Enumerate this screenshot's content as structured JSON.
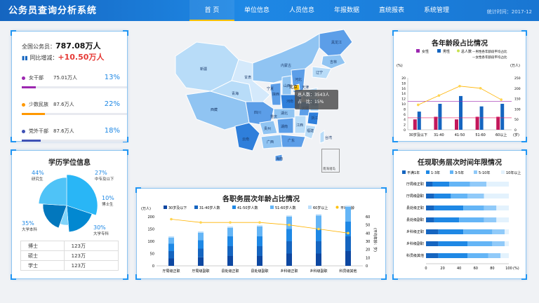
{
  "header": {
    "title": "公务员查询分析系统",
    "nav": [
      "首 页",
      "单位信息",
      "人员信息",
      "年报数据",
      "直统报表",
      "系统管理"
    ],
    "stat": "统计时间：2017-12"
  },
  "summary": {
    "total_label": "全国公务员：",
    "total_value": "787.08万人",
    "growth_label": "同比增减：",
    "growth_value": "+10.50万人",
    "items": [
      {
        "label": "女干部",
        "value": "75.01万人",
        "percent": "13%",
        "ratio": 0.13,
        "color": "#9c27b0"
      },
      {
        "label": "少数民族",
        "value": "87.6万人",
        "percent": "22%",
        "ratio": 0.22,
        "color": "#ff9800"
      },
      {
        "label": "党外干部",
        "value": "87.6万人",
        "percent": "18%",
        "ratio": 0.18,
        "color": "#3f51b5"
      }
    ]
  },
  "map": {
    "tooltip_title": "北京",
    "tooltip_count": "总人数：3543人",
    "tooltip_ratio": "占　比：15%",
    "inset_label": "南海诸岛",
    "provinces": [
      "黑龙江",
      "吉林",
      "辽宁",
      "内蒙古",
      "新疆",
      "西藏",
      "青海",
      "甘肃",
      "宁夏",
      "陕西",
      "山西",
      "河北",
      "山东",
      "河南",
      "四川",
      "重庆",
      "湖北",
      "湖南",
      "江西",
      "安徽",
      "江苏",
      "浙江",
      "福建",
      "广东",
      "广西",
      "贵州",
      "云南",
      "海南",
      "台湾",
      "天津",
      "北京"
    ]
  },
  "age_chart": {
    "title": "各年龄段占比情况",
    "legend": [
      "女性",
      "男性",
      "总人数",
      "男性各年龄段平均占比",
      "女性各年龄段平均占比"
    ],
    "ylabel_left": "(%)",
    "ylabel_right": "(万人)",
    "xunit": "(岁)",
    "categories": [
      "30岁及以下",
      "31-40",
      "41-50",
      "51-60",
      "60以上"
    ],
    "female": [
      4,
      5,
      4,
      5,
      5
    ],
    "male": [
      7,
      10,
      13,
      9,
      10
    ],
    "total": [
      120,
      165,
      210,
      200,
      145
    ],
    "male_avg": 11,
    "female_avg": 4.6,
    "y_left": [
      0,
      2,
      4,
      6,
      8,
      10,
      12,
      14,
      16,
      18,
      20
    ],
    "y_right": [
      0,
      50,
      100,
      150,
      200,
      250
    ]
  },
  "edu": {
    "title": "学历学位信息",
    "slices": [
      {
        "label": "研究生",
        "percent": "44%",
        "value": 44
      },
      {
        "label": "中专及以下",
        "percent": "27%",
        "value": 27
      },
      {
        "label": "博士生",
        "percent": "10%",
        "value": 10
      },
      {
        "label": "大学专科",
        "percent": "30%",
        "value": 30
      },
      {
        "label": "大学本科",
        "percent": "35%",
        "value": 35
      }
    ],
    "table": [
      [
        "博士",
        "123万"
      ],
      [
        "硕士",
        "123万"
      ],
      [
        "学士",
        "123万"
      ]
    ]
  },
  "level_chart": {
    "title": "各职务层次年龄占比情况",
    "ylabel_left": "(万人)",
    "ylabel_right": "(平均年龄：岁)",
    "legend": [
      "30岁及以下",
      "31-40岁人数",
      "41-50岁人数",
      "51-60岁人数",
      "60岁以上",
      "平均年龄"
    ],
    "categories": [
      "厅局级正职",
      "厅局级副职",
      "县处级正职",
      "县处级副职",
      "乡科级正职",
      "乡科级副职",
      "科员级其他"
    ],
    "stacks": [
      [
        30,
        30,
        30,
        25,
        5
      ],
      [
        35,
        35,
        35,
        30,
        5
      ],
      [
        40,
        40,
        40,
        35,
        5
      ],
      [
        40,
        40,
        40,
        40,
        5
      ],
      [
        50,
        50,
        50,
        50,
        5
      ],
      [
        50,
        50,
        50,
        55,
        5
      ],
      [
        60,
        60,
        60,
        60,
        5
      ]
    ],
    "avg": [
      57,
      53,
      53,
      53,
      50,
      45,
      40
    ],
    "y_left": [
      0,
      50,
      100,
      150,
      200
    ],
    "y_right": [
      0,
      10,
      20,
      30,
      40,
      50,
      60
    ]
  },
  "tenure": {
    "title": "任现职务层次时间年限情况",
    "legend": [
      "不满1年",
      "1-3年",
      "3-5年",
      "5-10年",
      "10年以上"
    ],
    "categories": [
      "厅局级正职",
      "厅局级副职",
      "县处级正职",
      "县处级副职",
      "乡科级正职",
      "乡科级副职",
      "科员级其他"
    ],
    "data": [
      [
        8,
        20,
        25,
        20,
        27
      ],
      [
        10,
        20,
        20,
        20,
        30
      ],
      [
        10,
        35,
        25,
        15,
        15
      ],
      [
        10,
        30,
        30,
        15,
        15
      ],
      [
        15,
        30,
        35,
        15,
        5
      ],
      [
        15,
        35,
        30,
        15,
        5
      ],
      [
        15,
        35,
        25,
        15,
        10
      ]
    ],
    "x_ticks": [
      0,
      20,
      40,
      60,
      80,
      100
    ],
    "xunit": "(%)"
  },
  "colors": {
    "blue1": "#0d47a1",
    "blue2": "#1565c0",
    "blue3": "#1e88e5",
    "blue4": "#64b5f6",
    "blue5": "#bbdefb",
    "accent": "#ffc107",
    "red": "#e53935"
  }
}
